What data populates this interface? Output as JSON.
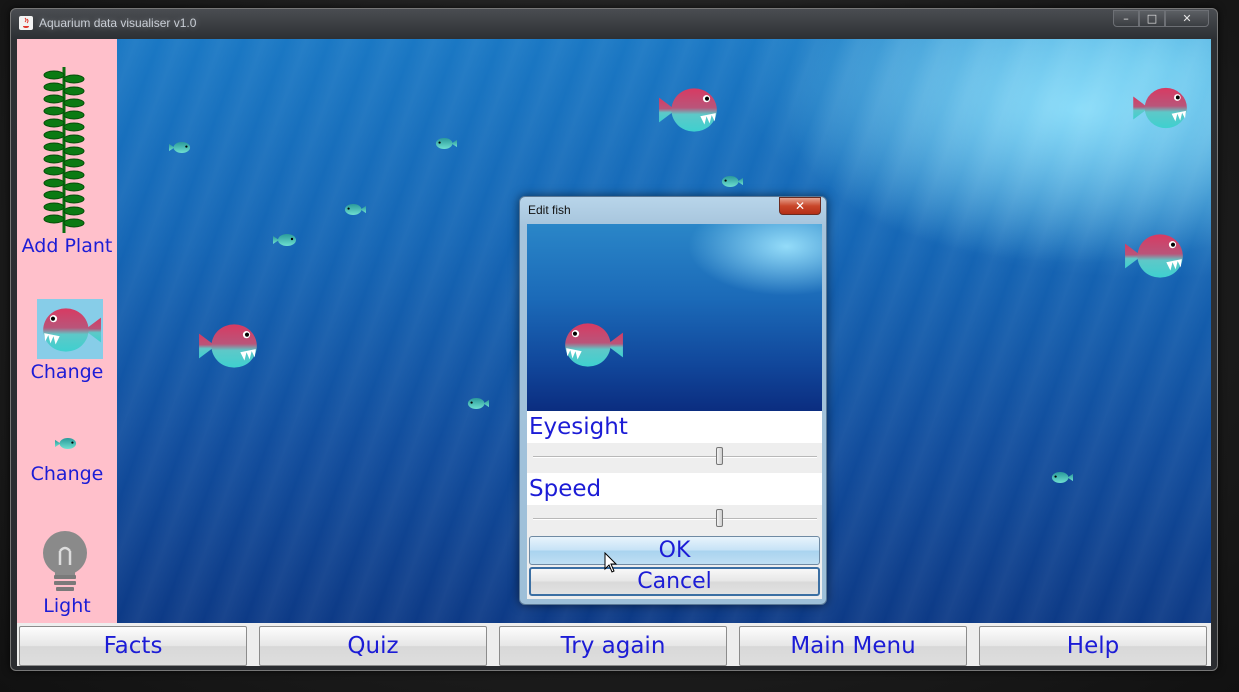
{
  "window": {
    "title": "Aquarium data visualiser v1.0",
    "controls": {
      "minimize": "–",
      "maximize": "□",
      "close": "✕"
    }
  },
  "sidebar": {
    "items": [
      {
        "label": "Add Plant",
        "icon": "plant-icon"
      },
      {
        "label": "Change",
        "icon": "big-fish-icon"
      },
      {
        "label": "Change",
        "icon": "small-fish-icon"
      },
      {
        "label": "Light",
        "icon": "light-bulb-icon"
      }
    ]
  },
  "bottom_bar": {
    "buttons": [
      "Facts",
      "Quiz",
      "Try again",
      "Main Menu",
      "Help"
    ]
  },
  "dialog": {
    "title": "Edit fish",
    "close": "✕",
    "eyesight": {
      "label": "Eyesight",
      "value_fraction": 0.66
    },
    "speed": {
      "label": "Speed",
      "value_fraction": 0.66
    },
    "ok_label": "OK",
    "cancel_label": "Cancel"
  },
  "colors": {
    "sidebar_bg": "#ffc0cb",
    "text_accent": "#1c1cd6",
    "fish_top": "#d1345e",
    "fish_bottom": "#35c6c8"
  }
}
